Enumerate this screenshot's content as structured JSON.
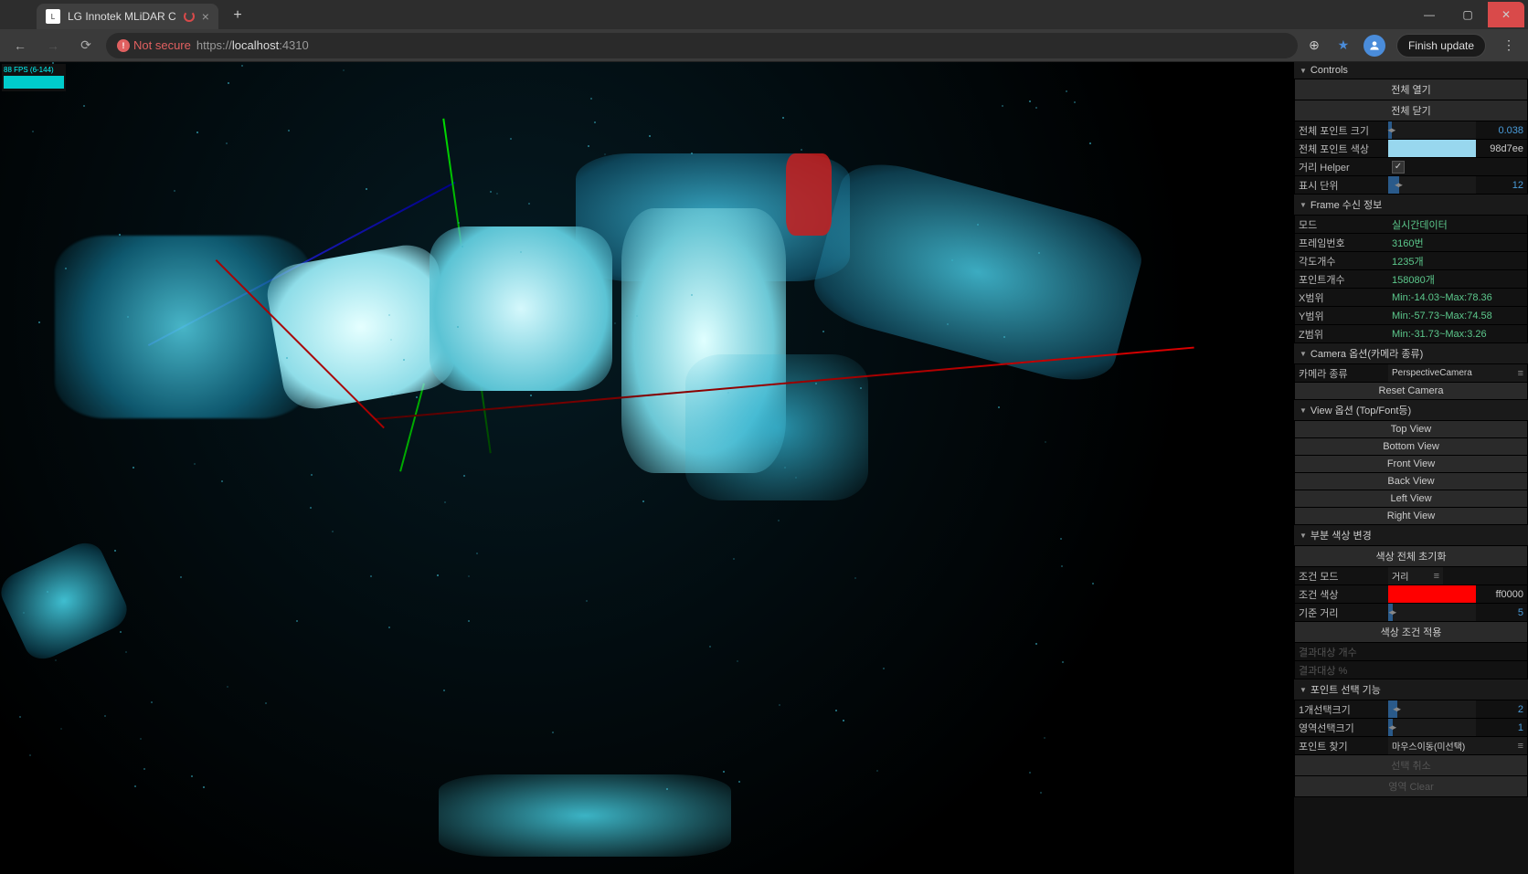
{
  "browser": {
    "tab_title": "LG Innotek MLiDAR C",
    "new_tab": "+",
    "nav_back": "←",
    "nav_forward": "→",
    "nav_reload": "⟳",
    "not_secure": "Not secure",
    "url_proto": "https://",
    "url_host": "localhost",
    "url_port": ":4310",
    "finish_update": "Finish update",
    "install_icon": "⊕",
    "star": "★",
    "profile": "👤",
    "menu": "⋮",
    "win_min": "—",
    "win_max": "▢",
    "win_close": "✕"
  },
  "stats": {
    "line1": "88 FPS (6-144)"
  },
  "panel": {
    "controls_header": "Controls",
    "open_all": "전체 열기",
    "close_all": "전체 닫기",
    "point_size_label": "전체 포인트 크기",
    "point_size_val": "0.038",
    "point_color_label": "전체 포인트 색상",
    "point_color_val": "98d7ee",
    "distance_helper_label": "거리 Helper",
    "display_unit_label": "표시 단위",
    "display_unit_val": "12",
    "frame_header": "Frame 수신 정보",
    "mode_label": "모드",
    "mode_val": "실시간데이터",
    "frame_no_label": "프레임번호",
    "frame_no_val": "3160번",
    "angle_count_label": "각도개수",
    "angle_count_val": "1235개",
    "point_count_label": "포인트개수",
    "point_count_val": "158080개",
    "x_range_label": "X범위",
    "x_range_val": "Min:-14.03~Max:78.36",
    "y_range_label": "Y범위",
    "y_range_val": "Min:-57.73~Max:74.58",
    "z_range_label": "Z범위",
    "z_range_val": "Min:-31.73~Max:3.26",
    "camera_header": "Camera 옵션(카메라 종류)",
    "camera_type_label": "카메라 종류",
    "camera_type_val": "PerspectiveCamera",
    "reset_camera": "Reset Camera",
    "view_header": "View 옵션 (Top/Font등)",
    "top_view": "Top View",
    "bottom_view": "Bottom View",
    "front_view": "Front View",
    "back_view": "Back View",
    "left_view": "Left View",
    "right_view": "Right View",
    "partial_color_header": "부분 색상 변경",
    "reset_colors": "색상 전체 초기화",
    "cond_mode_label": "조건 모드",
    "cond_mode_val": "거리",
    "cond_color_label": "조건 색상",
    "cond_color_val": "ff0000",
    "ref_dist_label": "기준 거리",
    "ref_dist_val": "5",
    "apply_color": "색상 조건 적용",
    "result_count_label": "결과대상 개수",
    "result_pct_label": "결과대상 %",
    "point_select_header": "포인트 선택 기능",
    "single_sel_label": "1개선택크기",
    "single_sel_val": "2",
    "area_sel_label": "영역선택크기",
    "area_sel_val": "1",
    "point_find_label": "포인트 찾기",
    "point_find_val": "마우스이동(미선택)",
    "cancel_sel": "선택 취소",
    "area_clear": "영역 Clear"
  }
}
